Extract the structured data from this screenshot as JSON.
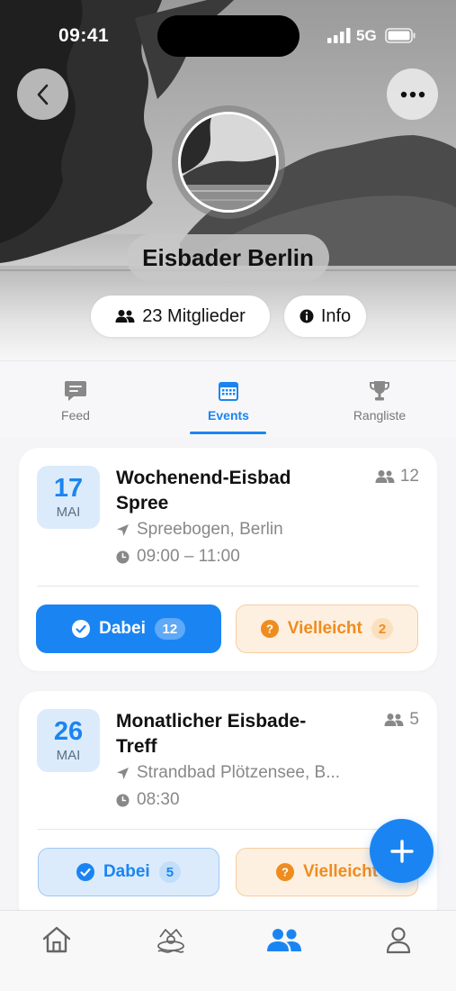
{
  "status_bar": {
    "time": "09:41",
    "network": "5G"
  },
  "group": {
    "name": "Eisbader Berlin",
    "members_label": "23 Mitglieder",
    "info_label": "Info"
  },
  "tabs": [
    {
      "label": "Feed",
      "icon": "chat-bubble-icon",
      "active": false
    },
    {
      "label": "Events",
      "icon": "calendar-icon",
      "active": true
    },
    {
      "label": "Rangliste",
      "icon": "trophy-icon",
      "active": false
    }
  ],
  "events": [
    {
      "day": "17",
      "month": "MAI",
      "title": "Wochenend-Eisbad Spree",
      "participants": "12",
      "location": "Spreebogen, Berlin",
      "time": "09:00 – 11:00",
      "yes_label": "Dabei",
      "yes_count": "12",
      "yes_selected": true,
      "maybe_label": "Vielleicht",
      "maybe_count": "2"
    },
    {
      "day": "26",
      "month": "MAI",
      "title": "Monatlicher Eisbade-Treff",
      "participants": "5",
      "location": "Strandbad Plötzensee, B...",
      "time": "08:30",
      "yes_label": "Dabei",
      "yes_count": "5",
      "yes_selected": false,
      "maybe_label": "Vielleicht",
      "maybe_count": ""
    }
  ],
  "bottom_nav": [
    {
      "icon": "home-icon",
      "active": false
    },
    {
      "icon": "swimmer-icon",
      "active": false
    },
    {
      "icon": "groups-icon",
      "active": true
    },
    {
      "icon": "profile-icon",
      "active": false
    }
  ],
  "colors": {
    "accent": "#1a85f2",
    "maybe": "#ef8c1f",
    "accent_light": "#dcebfb"
  }
}
